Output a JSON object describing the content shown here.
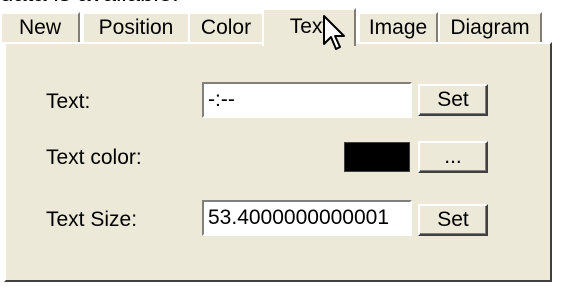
{
  "header_text": "data is available.",
  "tabs": [
    {
      "label": "New"
    },
    {
      "label": "Position"
    },
    {
      "label": "Color"
    },
    {
      "label": "Text",
      "active": true
    },
    {
      "label": "Image"
    },
    {
      "label": "Diagram"
    }
  ],
  "form": {
    "text": {
      "label": "Text:",
      "value": "-:--",
      "button": "Set"
    },
    "color": {
      "label": "Text color:",
      "value": "#000000",
      "button": "..."
    },
    "size": {
      "label": "Text Size:",
      "value": "53.4000000000001",
      "button": "Set"
    }
  },
  "colors": {
    "panel": "#ece9d8",
    "swatch": "#000000"
  },
  "icons": {
    "cursor": "arrow-pointer-icon"
  }
}
